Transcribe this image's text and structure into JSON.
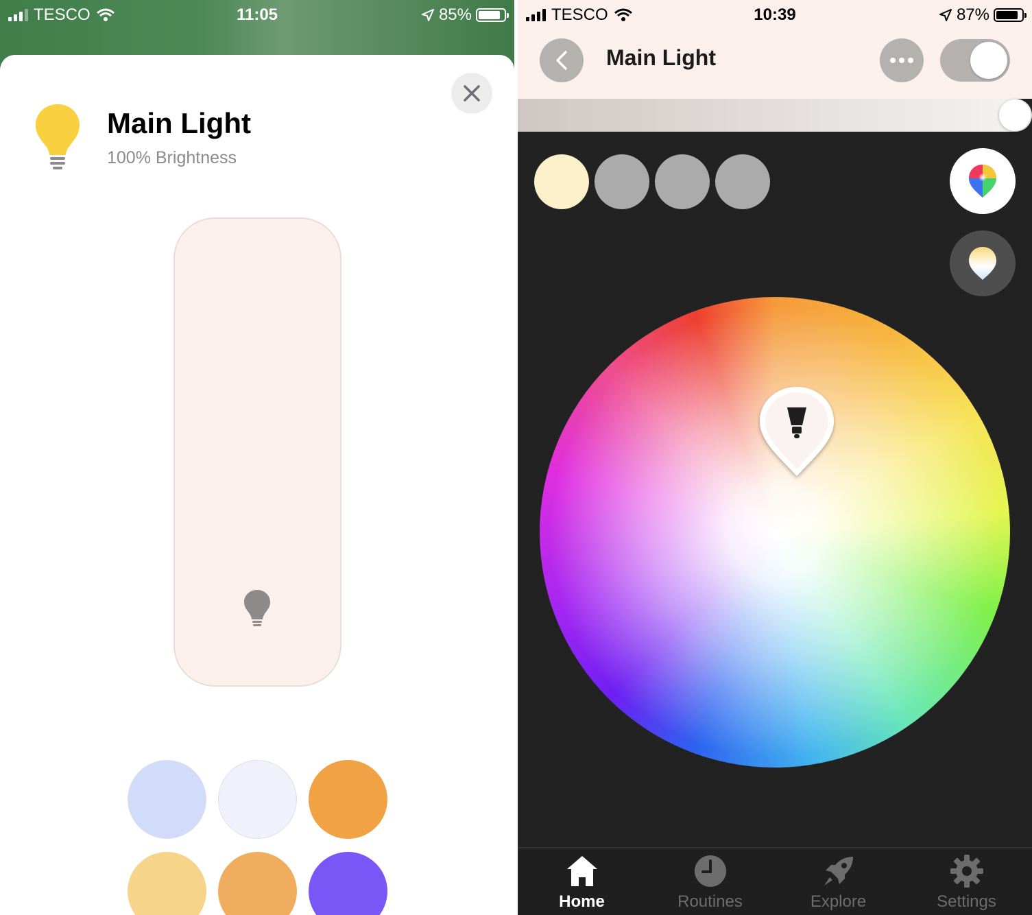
{
  "left_screen": {
    "status": {
      "carrier": "TESCO",
      "time": "11:05",
      "battery": "85%",
      "battery_level": 0.85
    },
    "title": "Main Light",
    "subtitle": "100% Brightness",
    "brightness_fraction": 1.0,
    "swatches": [
      {
        "name": "cool-blue",
        "color": "#d0dcf9"
      },
      {
        "name": "soft-white",
        "color": "#f1f1fb"
      },
      {
        "name": "orange",
        "color": "#f0a245"
      },
      {
        "name": "warm-yellow",
        "color": "#f6d58b"
      },
      {
        "name": "light-orange",
        "color": "#f0ad60"
      },
      {
        "name": "purple",
        "color": "#7857f6"
      }
    ]
  },
  "right_screen": {
    "status": {
      "carrier": "TESCO",
      "time": "10:39",
      "battery": "87%",
      "battery_level": 0.87
    },
    "title": "Main Light",
    "toggle_on": true,
    "brightness_fraction": 1.0,
    "scenes": [
      "#fcf1cb",
      "#ababab",
      "#ababab",
      "#ababab"
    ],
    "tabs": [
      {
        "label": "Home",
        "icon": "home-icon",
        "active": true
      },
      {
        "label": "Routines",
        "icon": "clock-icon",
        "active": false
      },
      {
        "label": "Explore",
        "icon": "rocket-icon",
        "active": false
      },
      {
        "label": "Settings",
        "icon": "gear-icon",
        "active": false
      }
    ]
  }
}
